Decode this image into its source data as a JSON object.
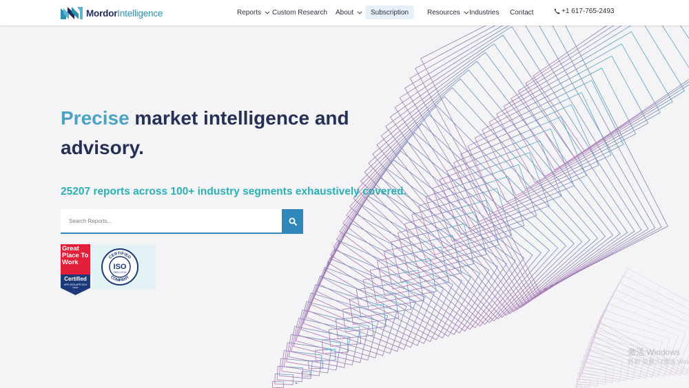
{
  "header": {
    "logo_bold": "Mordor",
    "logo_light": "Intelligence",
    "nav": {
      "reports": "Reports",
      "custom_research": "Custom Research",
      "about": "About",
      "subscription": "Subscription",
      "resources": "Resources",
      "industries": "Industries",
      "contact": "Contact"
    },
    "phone": "+1 617-765-2493"
  },
  "hero": {
    "headline_accent": "Precise",
    "headline_rest": " market intelligence and advisory.",
    "subline": "25207 reports across 100+ industry segments exhaustively covered.",
    "search_placeholder": "Search Reports..."
  },
  "badges": {
    "gptw_title": "Great Place To Work",
    "gptw_certified": "Certified",
    "gptw_dates": "APR 2023-APR 2024",
    "gptw_country": "INDIA",
    "iso_top": "CERTIFIED",
    "iso_main": "ISO",
    "iso_std": "9001:2015",
    "iso_bottom": "COMPANY"
  },
  "watermark": {
    "line1": "激活 Windows",
    "line2": "转到\"设置\"以激活 Windows"
  },
  "colors": {
    "accent_blue": "#2f86b8",
    "headline_accent": "#4aa3c5",
    "subline_teal": "#2bb0b5",
    "navy": "#243056"
  }
}
